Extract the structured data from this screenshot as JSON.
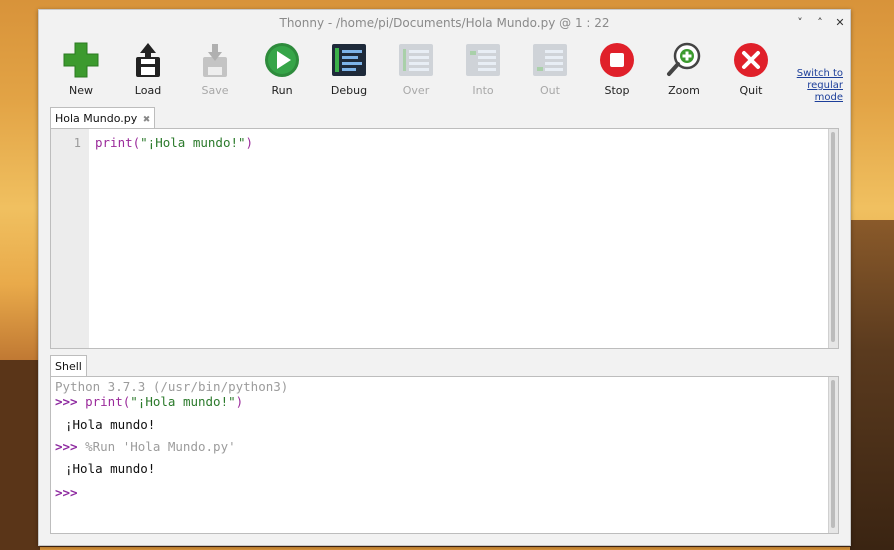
{
  "window": {
    "title": "Thonny  -  /home/pi/Documents/Hola Mundo.py  @  1 : 22",
    "controls": [
      "˅",
      "˄",
      "✕"
    ]
  },
  "toolbar": {
    "buttons": [
      {
        "label": "New",
        "icon": "new-icon",
        "enabled": true
      },
      {
        "label": "Load",
        "icon": "load-icon",
        "enabled": true
      },
      {
        "label": "Save",
        "icon": "save-icon",
        "enabled": false
      },
      {
        "label": "Run",
        "icon": "run-icon",
        "enabled": true
      },
      {
        "label": "Debug",
        "icon": "debug-icon",
        "enabled": true
      },
      {
        "label": "Over",
        "icon": "step-over-icon",
        "enabled": false
      },
      {
        "label": "Into",
        "icon": "step-into-icon",
        "enabled": false
      },
      {
        "label": "Out",
        "icon": "step-out-icon",
        "enabled": false
      },
      {
        "label": "Stop",
        "icon": "stop-icon",
        "enabled": true
      },
      {
        "label": "Zoom",
        "icon": "zoom-icon",
        "enabled": true
      },
      {
        "label": "Quit",
        "icon": "quit-icon",
        "enabled": true
      }
    ],
    "switch_mode_lines": [
      "Switch to",
      "regular",
      "mode"
    ]
  },
  "editor": {
    "tab_label": "Hola Mundo.py",
    "tab_close": "✖",
    "line_numbers": [
      "1"
    ],
    "code": {
      "func": "print(",
      "string": "\"¡Hola mundo!\"",
      "close": ")"
    }
  },
  "shell": {
    "tab_label": "Shell",
    "version_line": "Python 3.7.3 (/usr/bin/python3)",
    "prompt": ">>>",
    "cmd1_func": " print(",
    "cmd1_string": "\"¡Hola mundo!\"",
    "cmd1_close": ")",
    "output1": "¡Hola mundo!",
    "cmd2": " %Run 'Hola Mundo.py'",
    "output2": "¡Hola mundo!"
  },
  "colors": {
    "accent_green": "#3c9a2e",
    "run_green": "#2e8b3c",
    "stop_red": "#e0202a",
    "prompt_purple": "#8e2aa0",
    "link_blue": "#1d3f9a"
  }
}
